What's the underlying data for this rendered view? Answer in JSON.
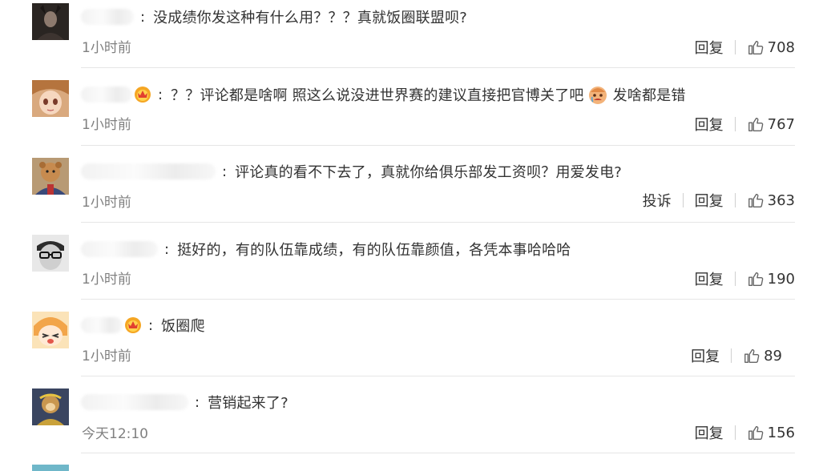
{
  "comments": [
    {
      "name_redacted": "",
      "text": "没成绩你发这种有什么用？？？真就饭圈联盟呗?",
      "time": "1小时前",
      "reply_label": "回复",
      "report_label": "",
      "likes": "708",
      "has_crown": false,
      "emoji_after": "",
      "avatar_icon": "dark-portrait-avatar"
    },
    {
      "name_redacted": "",
      "text": "？？评论都是啥啊 照这么说没进世界赛的建议直接把官博关了吧",
      "text2": "发啥都是错",
      "time": "1小时前",
      "reply_label": "回复",
      "report_label": "",
      "likes": "767",
      "has_crown": true,
      "emoji_after": "crying-emoji",
      "avatar_icon": "anime-girl-avatar"
    },
    {
      "name_redacted": "",
      "text": "评论真的看不下去了，真就你给俱乐部发工资呗？用爱发电?",
      "time": "1小时前",
      "reply_label": "回复",
      "report_label": "投诉",
      "likes": "363",
      "has_crown": false,
      "emoji_after": "",
      "avatar_icon": "bear-costume-avatar"
    },
    {
      "name_redacted": "",
      "text": "挺好的，有的队伍靠成绩，有的队伍靠颜值，各凭本事哈哈哈",
      "time": "1小时前",
      "reply_label": "回复",
      "report_label": "",
      "likes": "190",
      "has_crown": false,
      "emoji_after": "",
      "avatar_icon": "glasses-man-avatar"
    },
    {
      "name_redacted": "",
      "text": "饭圈爬",
      "time": "1小时前",
      "reply_label": "回复",
      "report_label": "",
      "likes": "89",
      "has_crown": true,
      "emoji_after": "",
      "avatar_icon": "cartoon-girl-avatar"
    },
    {
      "name_redacted": "",
      "text": "营销起来了?",
      "time": "今天12:10",
      "reply_label": "回复",
      "report_label": "",
      "likes": "156",
      "has_crown": false,
      "emoji_after": "",
      "avatar_icon": "monkey-king-avatar"
    }
  ],
  "colors": {
    "text": "#333333",
    "time": "#808080",
    "divider": "#e6e6e6"
  }
}
